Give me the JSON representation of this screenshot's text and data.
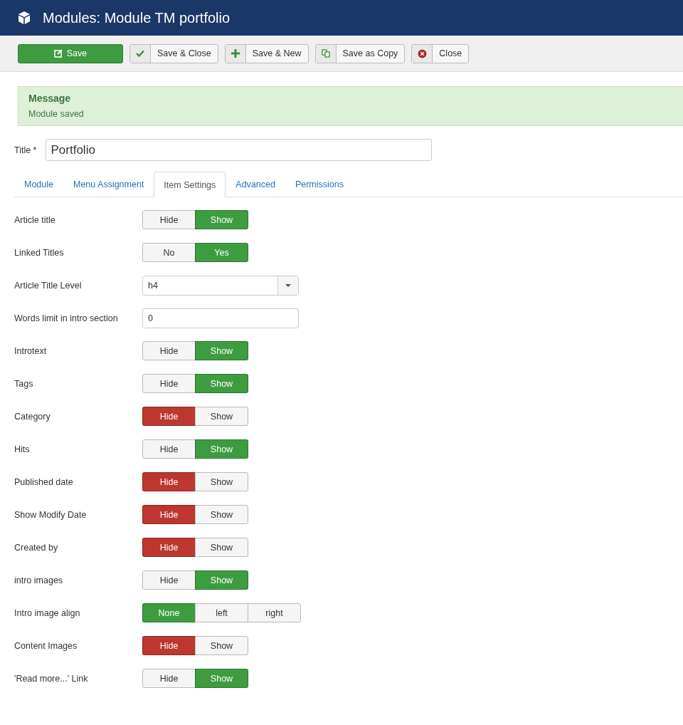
{
  "header": {
    "title": "Modules: Module TM portfolio"
  },
  "toolbar": [
    {
      "kind": "save",
      "label": "Save"
    },
    {
      "kind": "check",
      "label": "Save & Close"
    },
    {
      "kind": "plus",
      "label": "Save & New"
    },
    {
      "kind": "copy",
      "label": "Save as Copy"
    },
    {
      "kind": "close",
      "label": "Close"
    }
  ],
  "message": {
    "heading": "Message",
    "text": "Module saved"
  },
  "title_field": {
    "label": "Title *",
    "value": "Portfolio"
  },
  "tabs": [
    {
      "label": "Module",
      "selected": false
    },
    {
      "label": "Menu Assignment",
      "selected": false
    },
    {
      "label": "Item Settings",
      "selected": true
    },
    {
      "label": "Advanced",
      "selected": false
    },
    {
      "label": "Permissions",
      "selected": false
    }
  ],
  "rows": [
    {
      "kind": "toggle",
      "label": "Article title",
      "options": [
        {
          "label": "Hide",
          "selected": false
        },
        {
          "label": "Show",
          "selected": true,
          "color": "#3d9c40"
        }
      ]
    },
    {
      "kind": "toggle",
      "label": "Linked Titles",
      "options": [
        {
          "label": "No",
          "selected": false
        },
        {
          "label": "Yes",
          "selected": true,
          "color": "#3d9c40"
        }
      ]
    },
    {
      "kind": "select",
      "label": "Article Title Level",
      "value": "h4"
    },
    {
      "kind": "text",
      "label": "Words limit in intro section",
      "value": "0"
    },
    {
      "kind": "toggle",
      "label": "Introtext",
      "options": [
        {
          "label": "Hide",
          "selected": false
        },
        {
          "label": "Show",
          "selected": true,
          "color": "#3d9c40"
        }
      ]
    },
    {
      "kind": "toggle",
      "label": "Tags",
      "options": [
        {
          "label": "Hide",
          "selected": false
        },
        {
          "label": "Show",
          "selected": true,
          "color": "#3d9c40"
        }
      ]
    },
    {
      "kind": "toggle",
      "label": "Category",
      "options": [
        {
          "label": "Hide",
          "selected": true,
          "color": "#bd362f"
        },
        {
          "label": "Show",
          "selected": false
        }
      ]
    },
    {
      "kind": "toggle",
      "label": "Hits",
      "options": [
        {
          "label": "Hide",
          "selected": false
        },
        {
          "label": "Show",
          "selected": true,
          "color": "#3d9c40"
        }
      ]
    },
    {
      "kind": "toggle",
      "label": "Published date",
      "options": [
        {
          "label": "Hide",
          "selected": true,
          "color": "#bd362f"
        },
        {
          "label": "Show",
          "selected": false
        }
      ]
    },
    {
      "kind": "toggle",
      "label": "Show Modify Date",
      "options": [
        {
          "label": "Hide",
          "selected": true,
          "color": "#bd362f"
        },
        {
          "label": "Show",
          "selected": false
        }
      ]
    },
    {
      "kind": "toggle",
      "label": "Created by",
      "options": [
        {
          "label": "Hide",
          "selected": true,
          "color": "#bd362f"
        },
        {
          "label": "Show",
          "selected": false
        }
      ]
    },
    {
      "kind": "toggle",
      "label": "intro images",
      "options": [
        {
          "label": "Hide",
          "selected": false
        },
        {
          "label": "Show",
          "selected": true,
          "color": "#3d9c40"
        }
      ]
    },
    {
      "kind": "toggle",
      "label": "Intro image align",
      "options": [
        {
          "label": "None",
          "selected": true,
          "color": "#3d9c40"
        },
        {
          "label": "left",
          "selected": false
        },
        {
          "label": "right",
          "selected": false
        }
      ]
    },
    {
      "kind": "toggle",
      "label": "Content Images",
      "options": [
        {
          "label": "Hide",
          "selected": true,
          "color": "#bd362f"
        },
        {
          "label": "Show",
          "selected": false
        }
      ]
    },
    {
      "kind": "toggle",
      "label": "'Read more...' Link",
      "options": [
        {
          "label": "Hide",
          "selected": false
        },
        {
          "label": "Show",
          "selected": true,
          "color": "#3d9c40"
        }
      ]
    }
  ]
}
